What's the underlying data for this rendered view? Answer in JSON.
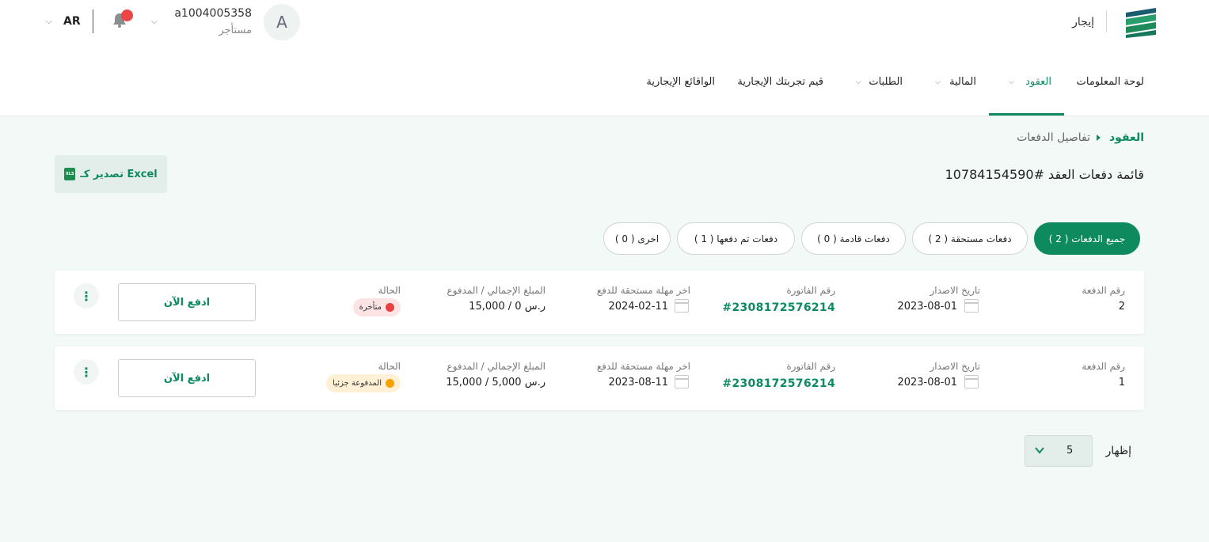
{
  "header": {
    "brand_label": "إيجار",
    "language": "AR",
    "user": {
      "id": "a1004005358",
      "role": "مستأجر",
      "avatar_initial": "A"
    },
    "notifications_icon": "bell-icon"
  },
  "nav": {
    "items": [
      {
        "label": "لوحة المعلومات",
        "active": false,
        "dropdown": false
      },
      {
        "label": "العقود",
        "active": true,
        "dropdown": true
      },
      {
        "label": "المالية",
        "active": false,
        "dropdown": true
      },
      {
        "label": "الطلبات",
        "active": false,
        "dropdown": true
      },
      {
        "label": "قيم تجربتك الإيجارية",
        "active": false,
        "dropdown": false
      },
      {
        "label": "الواقائع الإيجارية",
        "active": false,
        "dropdown": false
      }
    ]
  },
  "breadcrumb": {
    "root": "العقود",
    "current": "تفاصيل الدفعات"
  },
  "page": {
    "title": "قائمة دفعات العقد #10784154590",
    "export_label": "تصدير كـ Excel",
    "export_icon_text": "XLS"
  },
  "tabs": [
    {
      "label": "جميع الدفعات ( 2 )",
      "active": true
    },
    {
      "label": "دفعات مستحقة ( 2 )",
      "active": false
    },
    {
      "label": "دفعات قادمة ( 0 )",
      "active": false
    },
    {
      "label": "دفعات تم دفعها ( 1 )",
      "active": false
    },
    {
      "label": "اخرى ( 0 )",
      "active": false
    }
  ],
  "columns": {
    "payment_no": "رقم الدفعة",
    "issue_date": "تاريخ الاصدار",
    "invoice_no": "رقم الفاتورة",
    "due_date": "اخر مهلة مستحقة للدفع",
    "amount": "المبلغ الإجمالي / المدفوع",
    "status": "الحالة"
  },
  "payments": [
    {
      "payment_no": "2",
      "issue_date": "2023-08-01",
      "invoice_no": "#2308172576214",
      "due_date": "2024-02-11",
      "amount": "15,000 / 0 ر.س",
      "status": "متأخرة",
      "status_color": "#ea3f3f",
      "pay_label": "ادفع الآن"
    },
    {
      "payment_no": "1",
      "issue_date": "2023-08-01",
      "invoice_no": "#2308172576214",
      "due_date": "2023-08-11",
      "amount": "15,000 / 5,000 ر.س",
      "status": "المدفوعة جزئيا",
      "status_color": "#f5a100",
      "pay_label": "ادفع الآن"
    }
  ],
  "pagination": {
    "show_label": "إظهار",
    "page_size": "5"
  },
  "colors": {
    "brand": "#0e8a5f",
    "background": "#f2f9f7",
    "late": "#ea3f3f",
    "partial": "#f5a100"
  }
}
